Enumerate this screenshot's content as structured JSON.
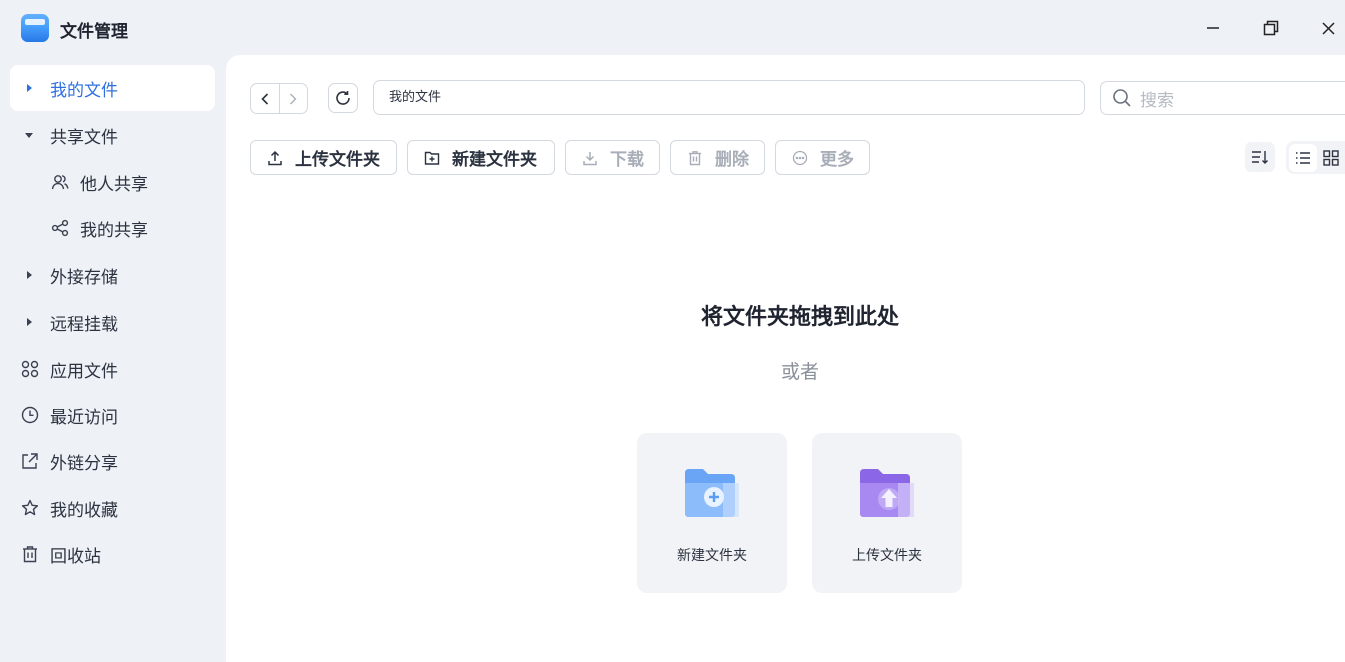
{
  "app": {
    "title": "文件管理",
    "icon": "folder-app-icon",
    "accent": "#2f6fdf"
  },
  "window": {
    "minimize": "minimize-icon",
    "restore": "restore-icon",
    "close": "close-icon"
  },
  "sidebar": {
    "items": [
      {
        "label": "我的文件",
        "icon": "caret-right-icon",
        "active": true
      },
      {
        "label": "共享文件",
        "icon": "caret-down-icon"
      },
      {
        "label": "他人共享",
        "icon": "users-icon"
      },
      {
        "label": "我的共享",
        "icon": "share-icon"
      },
      {
        "label": "外接存储",
        "icon": "caret-right-icon"
      },
      {
        "label": "远程挂载",
        "icon": "caret-right-icon"
      },
      {
        "label": "应用文件",
        "icon": "apps-icon"
      },
      {
        "label": "最近访问",
        "icon": "clock-icon"
      },
      {
        "label": "外链分享",
        "icon": "external-link-icon"
      },
      {
        "label": "我的收藏",
        "icon": "star-icon"
      },
      {
        "label": "回收站",
        "icon": "trash-icon"
      }
    ]
  },
  "pathbar": {
    "path": "我的文件"
  },
  "search": {
    "placeholder": "搜索"
  },
  "toolbar": {
    "upload_folder": "上传文件夹",
    "new_folder": "新建文件夹",
    "download": "下载",
    "delete": "删除",
    "more": "更多"
  },
  "empty": {
    "title": "将文件夹拖拽到此处",
    "or": "或者",
    "cards": [
      {
        "label": "新建文件夹",
        "icon": "new-folder-icon",
        "color": "#5b9cf2"
      },
      {
        "label": "上传文件夹",
        "icon": "upload-folder-icon",
        "color": "#8f6ce8"
      }
    ]
  }
}
